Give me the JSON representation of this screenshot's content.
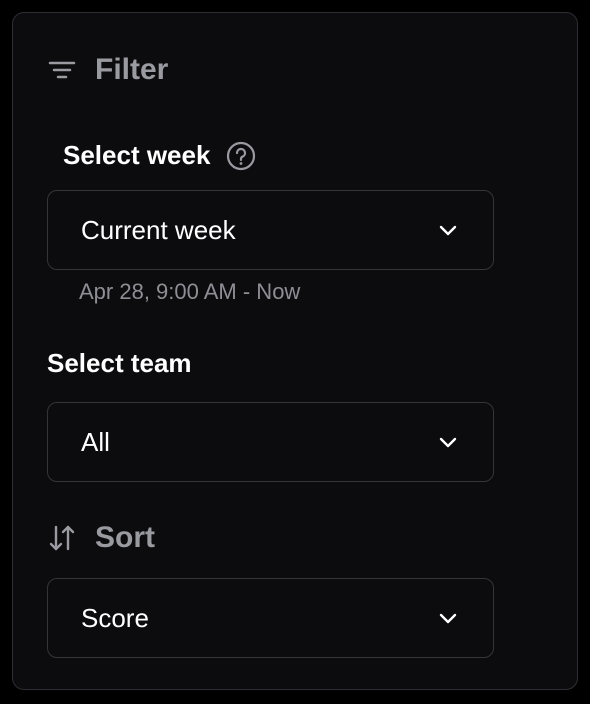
{
  "filter": {
    "title": "Filter",
    "icon": "filter-icon"
  },
  "week": {
    "label": "Select week",
    "help_icon": "question-circle-icon",
    "value": "Current week",
    "hint": "Apr 28, 9:00 AM - Now"
  },
  "team": {
    "label": "Select team",
    "value": "All"
  },
  "sort": {
    "title": "Sort",
    "icon": "sort-arrows-icon",
    "value": "Score"
  },
  "colors": {
    "background": "#0c0c0e",
    "border": "#34343a",
    "text": "#ffffff",
    "muted": "#9a9aa1"
  }
}
